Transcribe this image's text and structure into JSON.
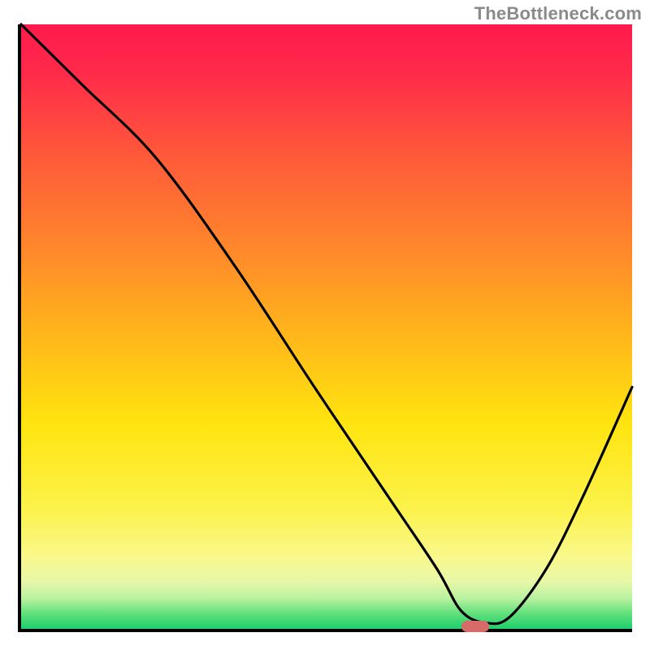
{
  "watermark": "TheBottleneck.com",
  "chart_data": {
    "type": "line",
    "title": "",
    "xlabel": "",
    "ylabel": "",
    "xlim": [
      0,
      100
    ],
    "ylim": [
      0,
      100
    ],
    "grid": false,
    "background": "gradient red-yellow-green (top=red high mismatch, bottom=green low mismatch)",
    "series": [
      {
        "name": "bottleneck-curve",
        "x": [
          0,
          10,
          22,
          35,
          48,
          60,
          68,
          72,
          76,
          80,
          86,
          92,
          100
        ],
        "y": [
          100,
          90,
          78,
          60,
          40,
          22,
          10,
          3,
          1,
          2,
          10,
          22,
          40
        ]
      }
    ],
    "marker": {
      "name": "optimal-point",
      "x": 74,
      "y": 1
    },
    "legend": false
  }
}
